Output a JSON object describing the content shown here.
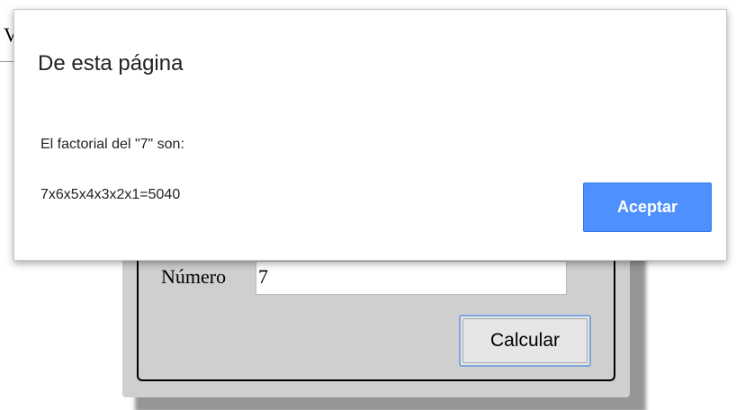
{
  "background": {
    "peek_text": "V"
  },
  "form": {
    "number_label": "Número",
    "number_value": "7",
    "calculate_label": "Calcular"
  },
  "dialog": {
    "title": "De esta página",
    "message_line1": "El factorial del \"7\" son:",
    "message_line2": "7x6x5x4x3x2x1=5040",
    "accept_label": "Aceptar"
  },
  "colors": {
    "accent": "#4d90fe",
    "panel": "#cfcfcf"
  }
}
